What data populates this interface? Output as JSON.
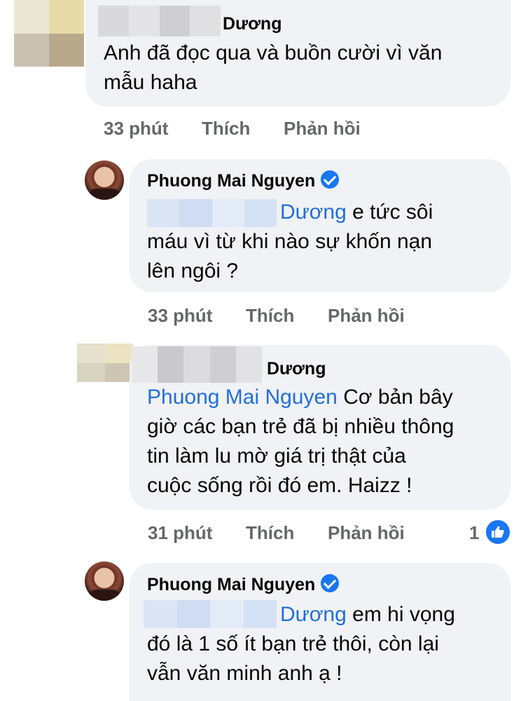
{
  "comments": [
    {
      "author": "Dương",
      "text": "Anh đã đọc qua và buồn cười vì văn mẫu haha",
      "line1": "Anh đã đọc qua và buồn cười vì văn",
      "line2": "mẫu haha",
      "time": "33 phút",
      "like": "Thích",
      "reply": "Phản hồi"
    },
    {
      "author": "Phuong Mai Nguyen",
      "mention": "Dương",
      "line1": "e tức sôi",
      "line2": "máu vì từ khi nào sự khốn nạn",
      "line3": "lên ngôi ?",
      "time": "33 phút",
      "like": "Thích",
      "reply": "Phản hồi"
    },
    {
      "author": "Dương",
      "mention": "Phuong Mai Nguyen",
      "line1": "Cơ bản bây",
      "line2": "giờ các bạn trẻ đã bị nhiều thông",
      "line3": "tin làm lu mờ giá trị thật của",
      "line4": "cuộc sống rồi đó em. Haizz !",
      "time": "31 phút",
      "like": "Thích",
      "reply": "Phản hồi",
      "reaction_count": "1"
    },
    {
      "author": "Phuong Mai Nguyen",
      "mention": "Dương",
      "line1": "em hi vọng",
      "line2": "đó là 1 số ít bạn trẻ thôi, còn lại",
      "line3": "vẫn văn minh anh ạ !"
    }
  ],
  "colors": {
    "bubble": "#f0f2f5",
    "mention": "#216fdb",
    "meta": "#65676b",
    "like": "#1877f2"
  }
}
